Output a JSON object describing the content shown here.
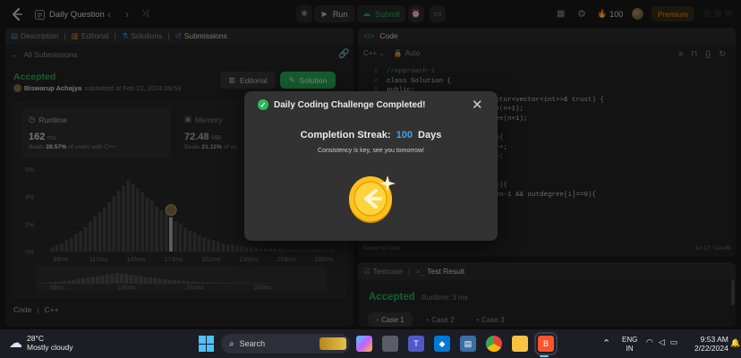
{
  "nav": {
    "title": "Daily Question",
    "run": "Run",
    "submit": "Submit",
    "fire_count": "100",
    "premium": "Premium"
  },
  "left_tabs": [
    "Description",
    "Editorial",
    "Solutions",
    "Submissions"
  ],
  "submission": {
    "back": "All Submissions",
    "status": "Accepted",
    "user": "Biswarup Achajya",
    "submitted": "submitted at Feb 22, 2024 09:53",
    "editorial_btn": "Editorial",
    "solution_btn": "Solution",
    "runtime_label": "Runtime",
    "runtime_value": "162",
    "runtime_unit": "ms",
    "runtime_beats_pre": "Beats",
    "runtime_beats_pct": "28.57%",
    "runtime_beats_post": "of users with C++",
    "memory_label": "Memory",
    "memory_value": "72.48",
    "memory_unit": "MB",
    "memory_beats_pre": "Beats",
    "memory_beats_pct": "21.11%",
    "memory_beats_post": "of us"
  },
  "chart_data": {
    "type": "bar",
    "y_ticks": [
      "6%",
      "4%",
      "2%",
      "0%"
    ],
    "x_ticks": [
      "89ms",
      "117ms",
      "145ms",
      "173ms",
      "201ms",
      "230ms",
      "258ms",
      "286ms"
    ],
    "mini_ticks": [
      "89ms",
      "145ms",
      "201ms",
      "258ms"
    ],
    "values": [
      0.3,
      0.5,
      0.6,
      0.8,
      1.0,
      1.3,
      1.5,
      1.8,
      2.2,
      2.6,
      2.9,
      3.2,
      3.6,
      4.0,
      4.4,
      4.8,
      5.2,
      4.9,
      4.6,
      4.3,
      3.9,
      3.7,
      3.3,
      3.0,
      2.8,
      2.5,
      2.2,
      2.0,
      1.7,
      1.5,
      1.4,
      1.2,
      1.0,
      0.9,
      0.8,
      0.7,
      0.6,
      0.5,
      0.5,
      0.4,
      0.4,
      0.3,
      0.3,
      0.3,
      0.2,
      0.2,
      0.2,
      0.2,
      0.2,
      0.1,
      0.1,
      0.1,
      0.1,
      0.1,
      0.1,
      0.1,
      0.1,
      0.1,
      0.1,
      0.1
    ],
    "highlight_index": 25
  },
  "code_section": {
    "label": "Code",
    "lang": "C++"
  },
  "editor": {
    "title": "Code",
    "lang": "C++",
    "auto": "Auto",
    "lines": [
      {
        "n": "1",
        "t": "//approach-1"
      },
      {
        "n": "2",
        "t": "class Solution {"
      },
      {
        "n": "3",
        "t": "public:"
      },
      {
        "n": "4",
        "t": "    int findJudge(int n, vector<vector<int>>& trust) {"
      },
      {
        "n": "5",
        "t": "        vector<int> indegree(n+1);"
      },
      {
        "n": "6",
        "t": "        vector<int> outdegree(n+1);"
      },
      {
        "n": "7",
        "t": ""
      },
      {
        "n": "8",
        "t": "        for(auto &v : trust){"
      },
      {
        "n": "9",
        "t": "            outdegree[v[0]]++;"
      },
      {
        "n": "10",
        "t": "            indegree[v[1]]++;"
      },
      {
        "n": "11",
        "t": "        }"
      },
      {
        "n": "12",
        "t": ""
      },
      {
        "n": "13",
        "t": "        for(int i=1;i<=n;i++){"
      },
      {
        "n": "14",
        "t": "            if(indegree[i]==n-1 && outdegree[i]==0){"
      },
      {
        "n": "15",
        "t": "                return i;"
      }
    ],
    "saved": "Saved to local",
    "cursor": "Ln 17, Col 49"
  },
  "result": {
    "tab1": "Testcase",
    "tab2": "Test Result",
    "status": "Accepted",
    "runtime": "Runtime: 3 ms",
    "cases": [
      "Case 1",
      "Case 2",
      "Case 3"
    ]
  },
  "modal": {
    "title": "Daily Coding Challenge Completed!",
    "streak_label": "Completion Streak:",
    "streak_value": "100",
    "streak_unit": "Days",
    "message": "Consistency is key, see you tomorrow!"
  },
  "taskbar": {
    "temp": "28°C",
    "weather": "Mostly cloudy",
    "search": "Search",
    "lang1": "ENG",
    "lang2": "IN",
    "time": "9:53 AM",
    "date": "2/22/2024"
  },
  "colors": {
    "accent_green": "#2cbb5d",
    "accent_blue": "#4a9cf5",
    "gold": "#ffc01e",
    "premium": "#ffa116"
  }
}
